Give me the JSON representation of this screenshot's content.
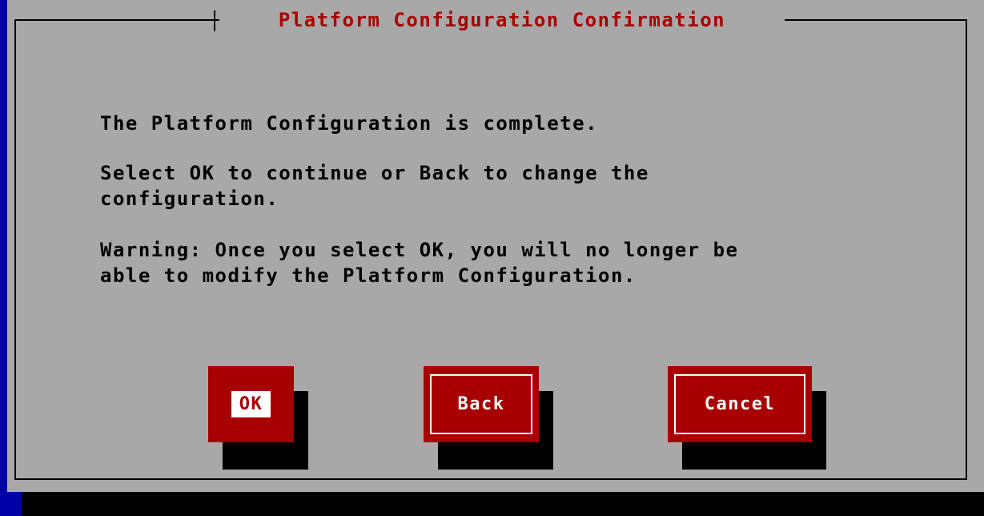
{
  "dialog": {
    "title": "Platform Configuration Confirmation",
    "message_line1": "The Platform Configuration is complete.",
    "message_line2a": "Select OK to continue or Back to change the",
    "message_line2b": "configuration.",
    "message_line3a": "Warning: Once you select OK, you will no longer be",
    "message_line3b": "able to modify the Platform Configuration."
  },
  "buttons": {
    "ok_label": "OK",
    "back_label": "Back",
    "cancel_label": "Cancel",
    "focused": "OK"
  },
  "colors": {
    "screen_background": "#0000a8",
    "dialog_background": "#a8a8a8",
    "title_text": "#a80000",
    "button_background": "#a80000",
    "button_text": "#ffffff",
    "shadow": "#000000"
  }
}
